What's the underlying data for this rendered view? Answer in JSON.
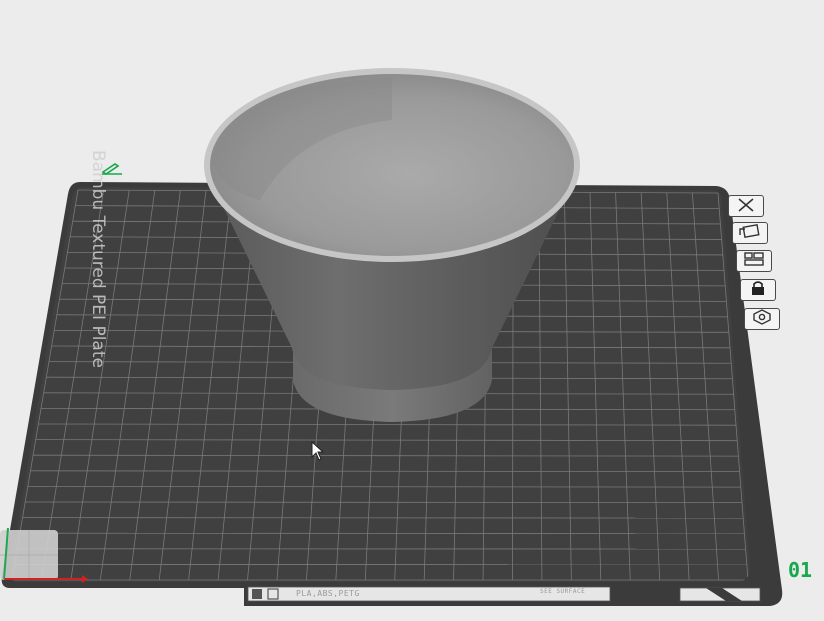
{
  "plate": {
    "name": "Bambu Textured PEI Plate",
    "number": "01"
  },
  "bottom_bar": {
    "filament_text": "PLA,ABS,PETG",
    "surface_text": "SEE SURFACE"
  },
  "side_toolbar": [
    {
      "name": "remove-plate-button",
      "icon": "close-icon"
    },
    {
      "name": "auto-orient-button",
      "icon": "orient-icon"
    },
    {
      "name": "arrange-button",
      "icon": "arrange-icon"
    },
    {
      "name": "lock-plate-button",
      "icon": "lock-icon"
    },
    {
      "name": "plate-settings-button",
      "icon": "gear-icon"
    }
  ],
  "colors": {
    "plate": "#3d3e3d",
    "grid": "#8a8a8a",
    "model": "#9c9c9c",
    "accent": "#17a84b",
    "axis_x": "#d62020",
    "axis_y": "#1fa84f"
  }
}
